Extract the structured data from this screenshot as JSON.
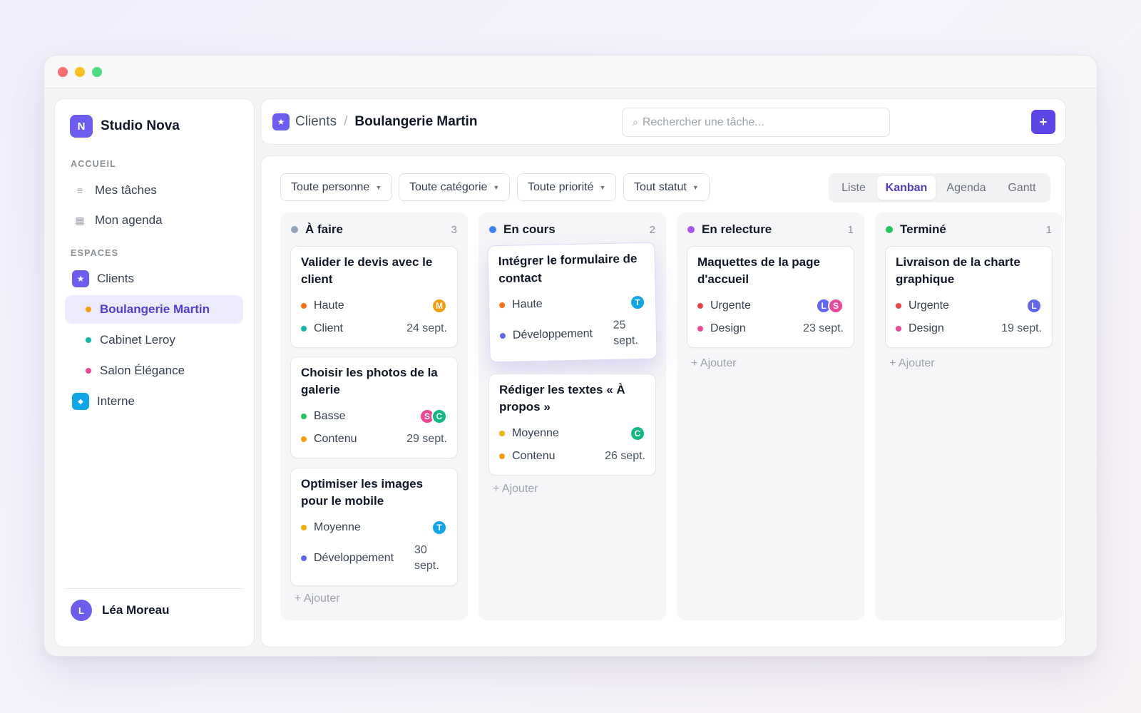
{
  "sidebar": {
    "brand_initial": "N",
    "brand_name": "Studio Nova",
    "section_home": "ACCUEIL",
    "my_tasks": "Mes tâches",
    "my_agenda": "Mon agenda",
    "section_spaces": "ESPACES",
    "space_clients": "Clients",
    "clients": [
      {
        "name": "Boulangerie Martin",
        "color": "#f59e0b",
        "active": true
      },
      {
        "name": "Cabinet Leroy",
        "color": "#14b8a6",
        "active": false
      },
      {
        "name": "Salon Élégance",
        "color": "#ec4899",
        "active": false
      }
    ],
    "space_internal": "Interne",
    "user_initial": "L",
    "user_name": "Léa Moreau"
  },
  "header": {
    "crumb_parent": "Clients",
    "crumb_separator": "/",
    "crumb_current": "Boulangerie Martin",
    "search_placeholder": "Rechercher une tâche...",
    "add_label": "+"
  },
  "filters": [
    "Toute personne",
    "Toute catégorie",
    "Toute priorité",
    "Tout statut"
  ],
  "views": [
    "Liste",
    "Kanban",
    "Agenda",
    "Gantt"
  ],
  "active_view": "Kanban",
  "add_task_label": "+ Ajouter",
  "colors": {
    "accent": "#5b45e6",
    "priority": {
      "Haute": "#f97316",
      "Basse": "#22c55e",
      "Moyenne": "#eab308",
      "Urgente": "#ef4444"
    },
    "category": {
      "Client": "#14b8a6",
      "Contenu": "#f59e0b",
      "Développement": "#6366f1",
      "Design": "#ec4899"
    },
    "avatars": {
      "M": "#f59e0b",
      "S": "#ec4899",
      "C": "#10b981",
      "T": "#0ea5e9",
      "L": "#6366f1"
    }
  },
  "columns": [
    {
      "title": "À faire",
      "count": "3",
      "color": "#94a3b8",
      "cards": [
        {
          "title": "Valider le devis avec le client",
          "priority": "Haute",
          "category": "Client",
          "date": "24 sept.",
          "assignees": [
            "M"
          ]
        },
        {
          "title": "Choisir les photos de la galerie",
          "priority": "Basse",
          "category": "Contenu",
          "date": "29 sept.",
          "assignees": [
            "S",
            "C"
          ]
        },
        {
          "title": "Optimiser les images pour le mobile",
          "priority": "Moyenne",
          "category": "Développement",
          "date": "30 sept.",
          "assignees": [
            "T"
          ]
        }
      ]
    },
    {
      "title": "En cours",
      "count": "2",
      "color": "#3b82f6",
      "cards": [
        {
          "title": "Intégrer le formulaire de contact",
          "priority": "Haute",
          "category": "Développement",
          "date": "25 sept.",
          "assignees": [
            "T"
          ]
        },
        {
          "title": "Rédiger les textes « À propos »",
          "priority": "Moyenne",
          "category": "Contenu",
          "date": "26 sept.",
          "assignees": [
            "C"
          ]
        }
      ]
    },
    {
      "title": "En relecture",
      "count": "1",
      "color": "#a855f7",
      "cards": [
        {
          "title": "Maquettes de la page d'accueil",
          "priority": "Urgente",
          "category": "Design",
          "date": "23 sept.",
          "assignees": [
            "L",
            "S"
          ]
        }
      ]
    },
    {
      "title": "Terminé",
      "count": "1",
      "color": "#22c55e",
      "cards": [
        {
          "title": "Livraison de la charte graphique",
          "priority": "Urgente",
          "category": "Design",
          "date": "19 sept.",
          "assignees": [
            "L"
          ]
        }
      ]
    }
  ]
}
